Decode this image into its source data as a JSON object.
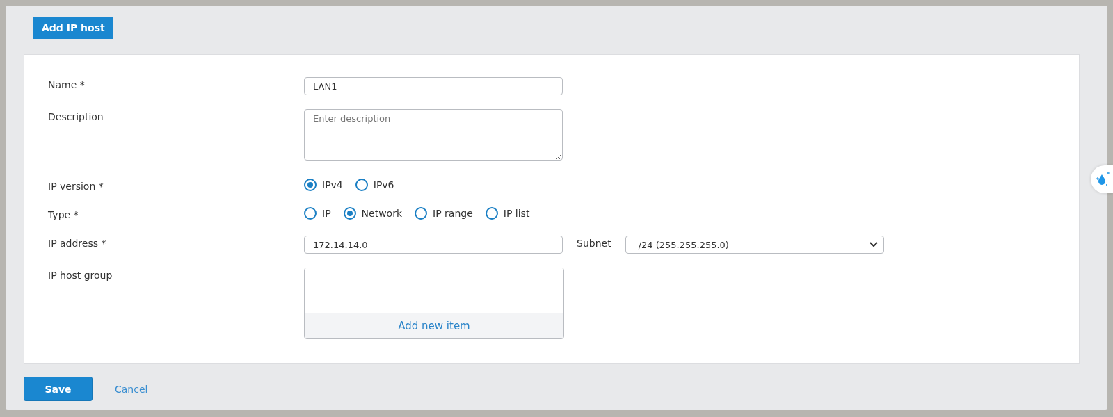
{
  "header": {
    "button": "Add IP host"
  },
  "form": {
    "name": {
      "label": "Name *",
      "value": "LAN1"
    },
    "description": {
      "label": "Description",
      "placeholder": "Enter description"
    },
    "ip_version": {
      "label": "IP version *",
      "options": [
        {
          "label": "IPv4",
          "selected": true
        },
        {
          "label": "IPv6",
          "selected": false
        }
      ]
    },
    "type": {
      "label": "Type *",
      "options": [
        {
          "label": "IP",
          "selected": false
        },
        {
          "label": "Network",
          "selected": true
        },
        {
          "label": "IP range",
          "selected": false
        },
        {
          "label": "IP list",
          "selected": false
        }
      ]
    },
    "ip_address": {
      "label": "IP address *",
      "value": "172.14.14.0"
    },
    "subnet": {
      "label": "Subnet",
      "value": "/24 (255.255.255.0)"
    },
    "ip_host_group": {
      "label": "IP host group",
      "add_button": "Add new item"
    }
  },
  "footer": {
    "save": "Save",
    "cancel": "Cancel"
  }
}
